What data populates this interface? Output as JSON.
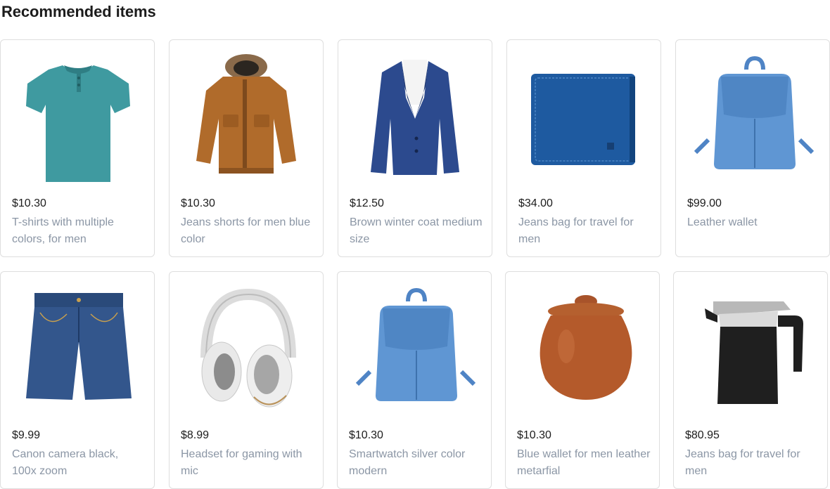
{
  "section_title": "Recommended items",
  "items": [
    {
      "price": "$10.30",
      "name": "T-shirts with multiple colors, for men",
      "icon": "tshirt-image"
    },
    {
      "price": "$10.30",
      "name": "Jeans shorts for men blue color",
      "icon": "jacket-image"
    },
    {
      "price": "$12.50",
      "name": "Brown winter coat medium size",
      "icon": "blazer-image"
    },
    {
      "price": "$34.00",
      "name": "Jeans bag for travel for men",
      "icon": "wallet-image"
    },
    {
      "price": "$99.00",
      "name": "Leather wallet",
      "icon": "backpack-image"
    },
    {
      "price": "$9.99",
      "name": "Canon camera black, 100x zoom",
      "icon": "jeans-shorts-image"
    },
    {
      "price": "$8.99",
      "name": "Headset for gaming with mic",
      "icon": "headphones-image"
    },
    {
      "price": "$10.30",
      "name": "Smartwatch silver color modern",
      "icon": "backpack-image"
    },
    {
      "price": "$10.30",
      "name": "Blue wallet for men leather metarfial",
      "icon": "clay-pot-image"
    },
    {
      "price": "$80.95",
      "name": "Jeans bag for travel for men",
      "icon": "kettle-image"
    }
  ]
}
